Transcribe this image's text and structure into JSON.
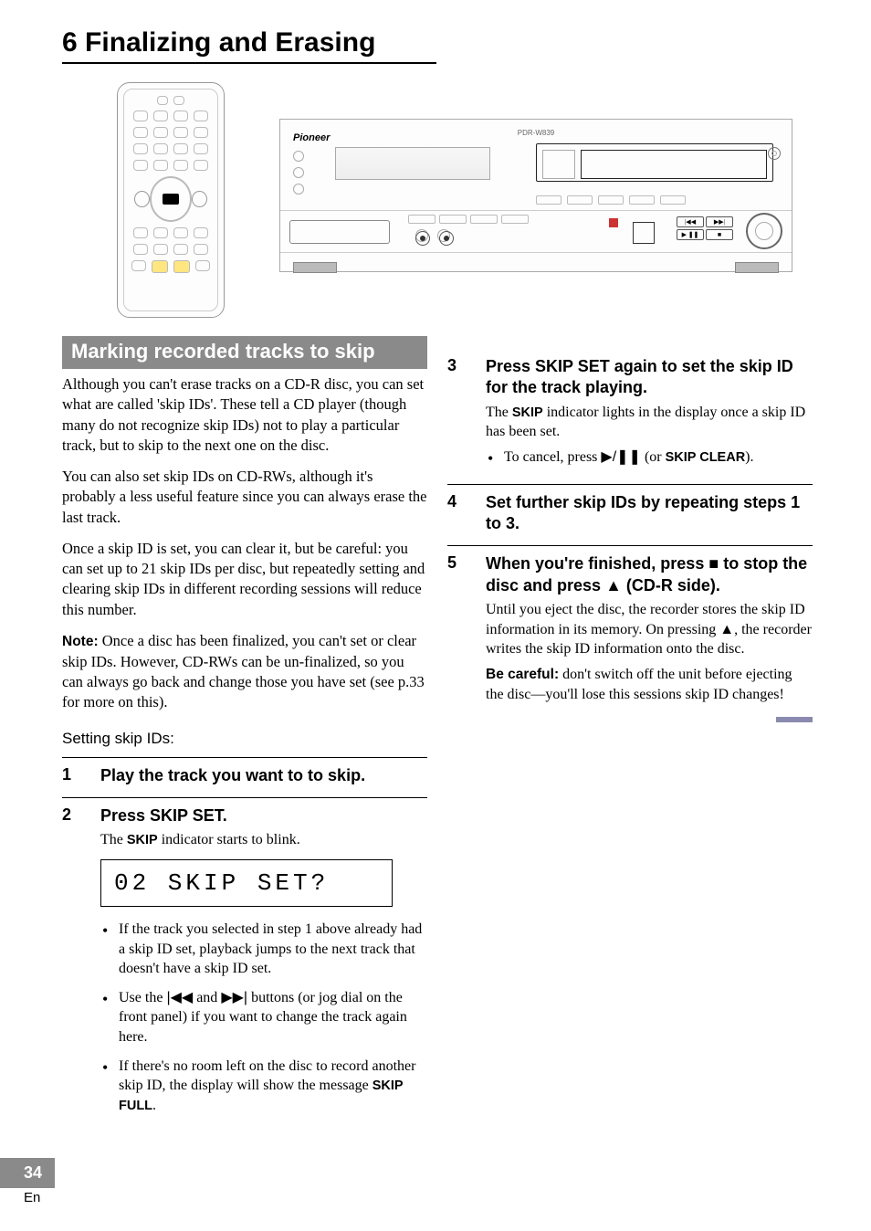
{
  "chapter": {
    "number": "6",
    "title": "Finalizing and Erasing"
  },
  "device": {
    "brand": "Pioneer",
    "model": "PDR-W839"
  },
  "section": {
    "heading": "Marking recorded tracks to skip",
    "para1": "Although you can't erase tracks on a CD-R disc, you can set what are called 'skip IDs'. These tell a CD player (though many do not recognize skip IDs) not to play a particular track, but to skip to the next one on the disc.",
    "para2": "You can also set skip IDs on CD-RWs, although it's probably a less useful feature since you can always erase the last track.",
    "para3": "Once a skip ID is set, you can clear it, but be careful: you can set up to 21 skip IDs per disc, but repeatedly setting and clearing skip IDs in different recording sessions will reduce this number.",
    "note_label": "Note:",
    "note_text": " Once a disc has been finalized, you can't set or clear skip IDs. However, CD-RWs can be un-finalized, so you can always go back and change those you have set (see p.33 for more on this).",
    "subhead": "Setting skip IDs:"
  },
  "steps_left": [
    {
      "num": "1",
      "title": "Play the track you want to to skip."
    },
    {
      "num": "2",
      "title": "Press SKIP SET.",
      "text_before": "The ",
      "indicator": "SKIP",
      "text_after": " indicator starts to blink.",
      "display": "02  SKIP  SET?",
      "bullets": [
        "If the track you selected in step 1 above already had a skip ID set, playback jumps to the next track that doesn't have a skip ID set.",
        "Use the |◀◀ and ▶▶| buttons (or jog dial on the front panel) if you want to change the track again here.",
        "If there's no room left on the disc to record another skip ID, the display will show the message SKIP FULL."
      ]
    }
  ],
  "steps_right": [
    {
      "num": "3",
      "title": "Press SKIP SET again to set the skip ID for the track playing.",
      "text_before": "The ",
      "indicator": "SKIP",
      "text_after": " indicator lights in the display once a skip ID has been set.",
      "bullets": [
        "To cancel, press ▶/❚❚ (or SKIP CLEAR)."
      ]
    },
    {
      "num": "4",
      "title": "Set further skip IDs by repeating steps 1 to 3."
    },
    {
      "num": "5",
      "title": "When you're finished, press ■ to stop the disc and press ▲ (CD-R side).",
      "text": "Until you eject the disc, the recorder stores the skip ID information in its memory. On pressing ▲, the recorder writes the skip ID information onto the disc.",
      "careful_label": "Be careful:",
      "careful_text": " don't switch off the unit before ejecting the disc—you'll lose this sessions skip ID changes!"
    }
  ],
  "footer": {
    "page": "34",
    "lang": "En"
  }
}
